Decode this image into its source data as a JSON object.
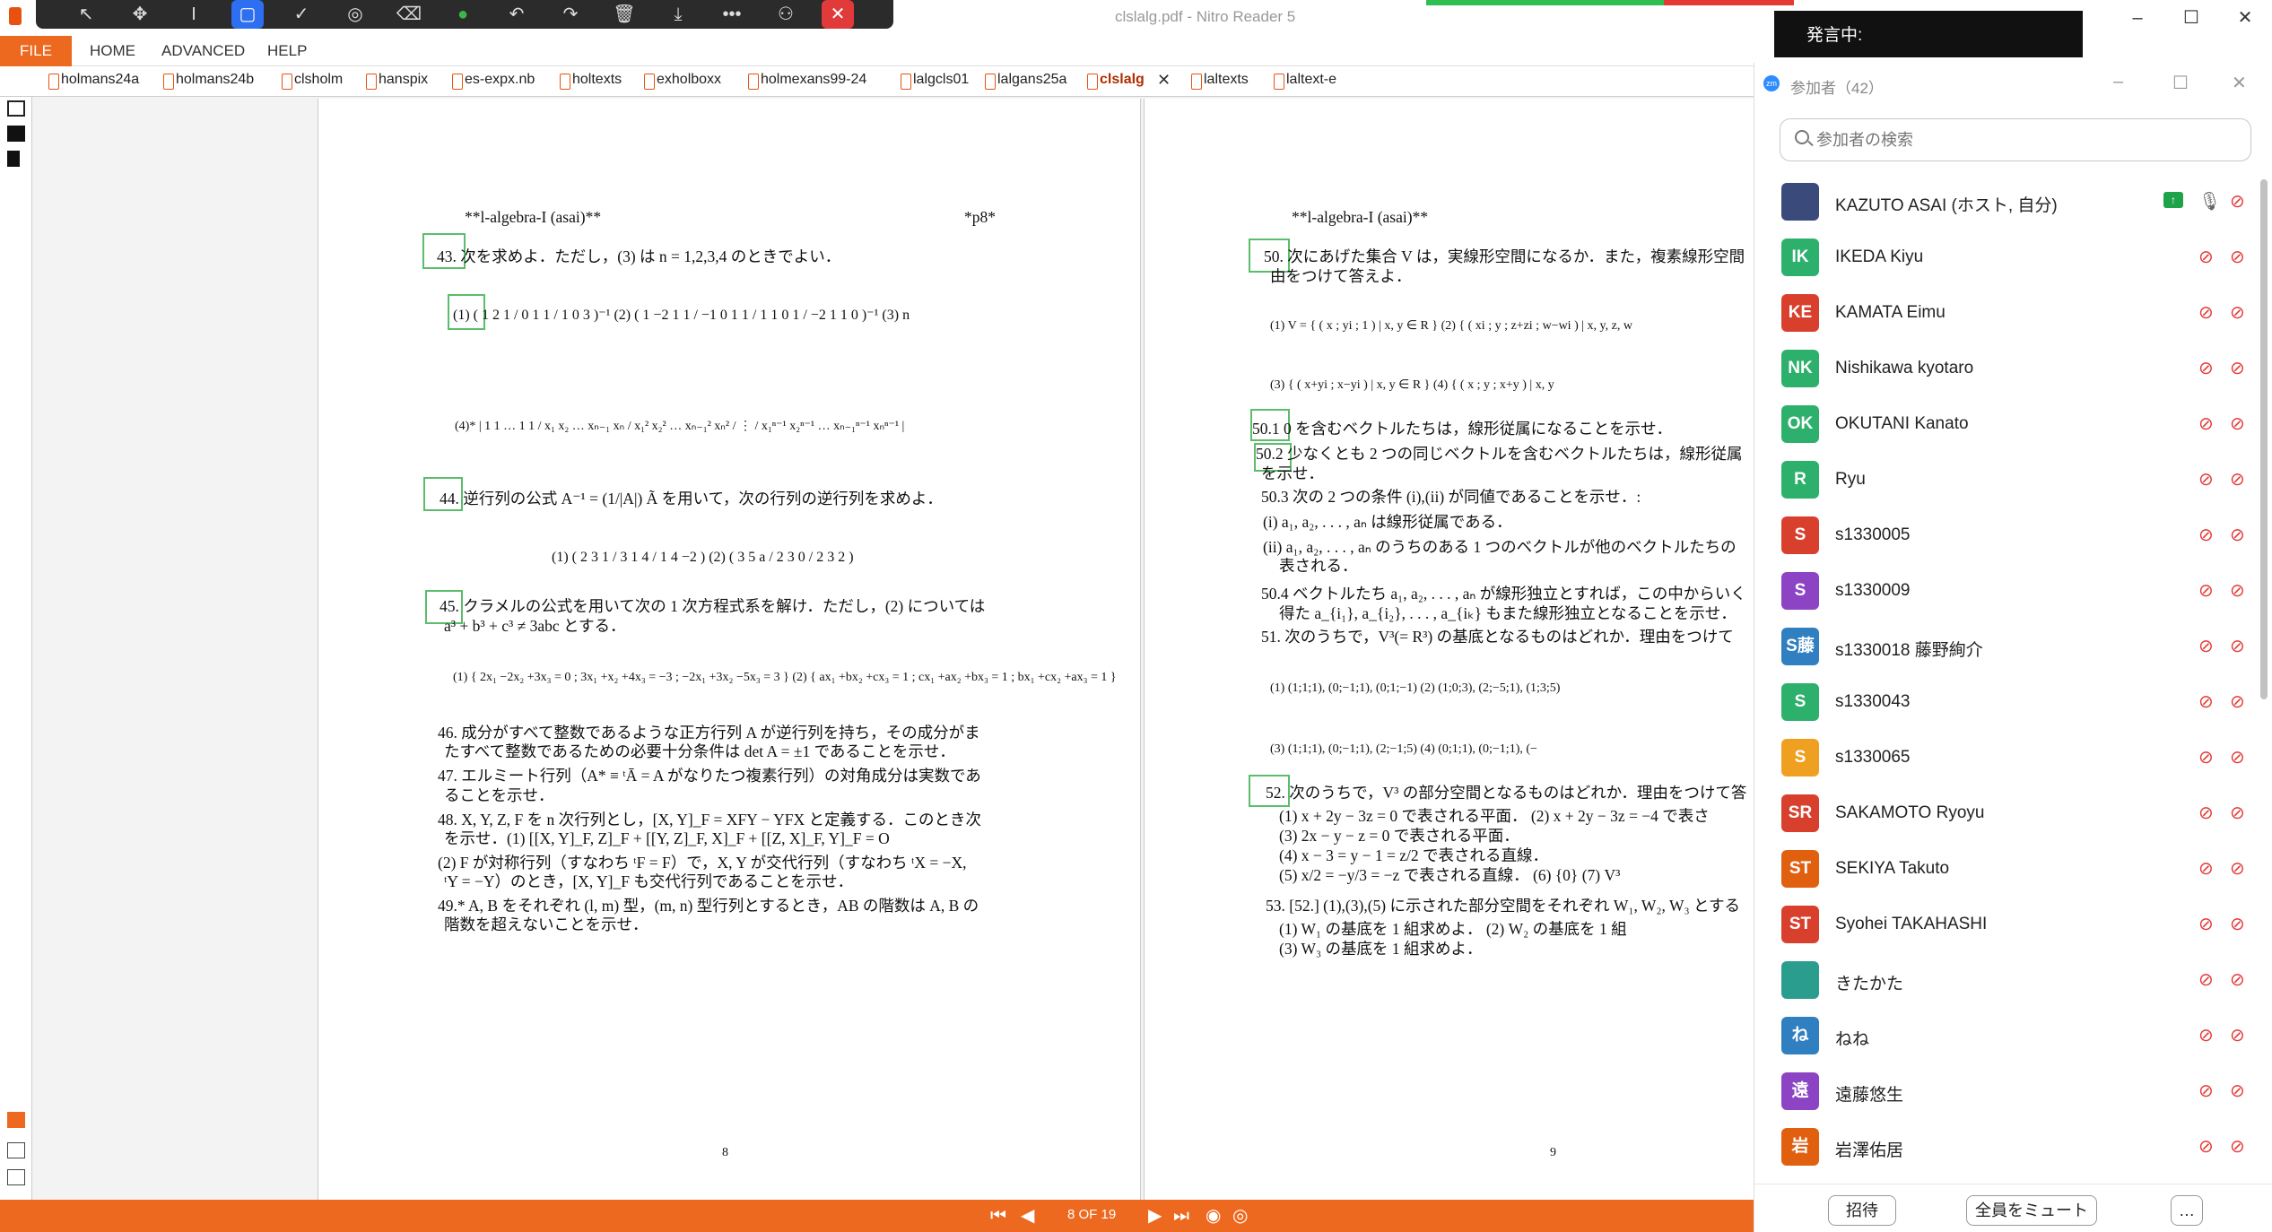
{
  "window": {
    "title": "clslalg.pdf - Nitro Reader 5",
    "controls": [
      "–",
      "☐",
      "✕"
    ]
  },
  "annotation_toolbar": {
    "icons": [
      "arrow-icon",
      "move-icon",
      "text-cursor-icon",
      "rectangle-icon",
      "check-icon",
      "stamp-icon",
      "eraser-icon",
      "green-dot-icon",
      "undo-icon",
      "redo-icon",
      "trash-icon",
      "download-icon",
      "more-icon",
      "people-icon",
      "close-icon"
    ]
  },
  "menu": {
    "file": "FILE",
    "home": "HOME",
    "advanced": "ADVANCED",
    "help": "HELP"
  },
  "tabs": [
    "holmans24a",
    "holmans24b",
    "clsholm",
    "hanspix",
    "es-expx.nb",
    "holtexts",
    "exholboxx",
    "holmexans99-24",
    "lalgcls01",
    "lalgans25a",
    "clslalg",
    "laltexts",
    "laltext-e"
  ],
  "active_tab": "clslalg",
  "page_left": {
    "header": "**l-algebra-I (asai)**",
    "header_right": "*p8*",
    "footer": "8",
    "lines": [
      "43. 次を求めよ．ただし，(3) は n = 1,2,3,4 のときでよい．",
      "(1) ( 1 2 1 / 0 1 1 / 1 0 3 )⁻¹     (2) ( 1 −2 1 1 / −1 0 1 1 / 1 1 0 1 / −2 1 1 0 )⁻¹     (3) n",
      "(4)*  | 1 1 … 1 1 / x₁ x₂ … xₙ₋₁ xₙ / x₁² x₂² … xₙ₋₁² xₙ² / ⋮ / x₁ⁿ⁻¹ x₂ⁿ⁻¹ … xₙ₋₁ⁿ⁻¹ xₙⁿ⁻¹ |",
      "44. 逆行列の公式 A⁻¹ = (1/|A|) Ã を用いて，次の行列の逆行列を求めよ．",
      "(1) ( 2 3 1 / 3 1 4 / 1 4 −2 )        (2) ( 3 5 a / 2 3 0 / 2 3 2 )",
      "45. クラメルの公式を用いて次の 1 次方程式系を解け．ただし，(2) については",
      "a³ + b³ + c³ ≠ 3abc とする．",
      "(1) { 2x₁ −2x₂ +3x₃ = 0 ; 3x₁ +x₂ +4x₃ = −3 ; −2x₁ +3x₂ −5x₃ = 3 }   (2) { ax₁ +bx₂ +cx₃ = 1 ; cx₁ +ax₂ +bx₃ = 1 ; bx₁ +cx₂ +ax₃ = 1 }",
      "46. 成分がすべて整数であるような正方行列 A が逆行列を持ち，その成分がま",
      "たすべて整数であるための必要十分条件は det A = ±1 であることを示せ．",
      "47. エルミート行列（A* ≡ ᵗĀ = A がなりたつ複素行列）の対角成分は実数であ",
      "ることを示せ．",
      "48. X, Y, Z, F を n 次行列とし，[X, Y]_F = XFY − YFX と定義する．このとき次",
      "を示せ．(1) [[X, Y]_F, Z]_F + [[Y, Z]_F, X]_F + [[Z, X]_F, Y]_F = O",
      "(2) F が対称行列（すなわち ᵗF = F）で，X, Y が交代行列（すなわち ᵗX = −X,",
      "ᵗY = −Y）のとき，[X, Y]_F も交代行列であることを示せ．",
      "49.* A, B をそれぞれ (l, m) 型，(m, n) 型行列とするとき，AB の階数は A, B の",
      "階数を超えないことを示せ．"
    ]
  },
  "page_right": {
    "header": "**l-algebra-I (asai)**",
    "footer": "9",
    "lines": [
      "50. 次にあげた集合 V は，実線形空間になるか．また，複素線形空間",
      "由をつけて答えよ．",
      "(1) V = { ( x ; yi ; 1 ) | x, y ∈ R }        (2) { ( xi ; y ; z+zi ; w−wi ) | x, y, z, w",
      "(3) { ( x+yi ; x−yi ) | x, y ∈ R }        (4) { ( x ; y ; x+y ) | x, y",
      "50.1 0 を含むベクトルたちは，線形従属になることを示せ．",
      "50.2 少なくとも 2 つの同じベクトルを含むベクトルたちは，線形従属",
      "を示せ．",
      "50.3 次の 2 つの条件 (i),(ii) が同値であることを示せ．:",
      "(i) a₁, a₂, . . . , aₙ は線形従属である．",
      "(ii) a₁, a₂, . . . , aₙ のうちのある 1 つのベクトルが他のベクトルたちの",
      "表される．",
      "50.4 ベクトルたち a₁, a₂, . . . , aₙ が線形独立とすれば，この中からいく",
      "得た a_{i₁}, a_{i₂}, . . . , a_{iₖ} もまた線形独立となることを示せ．",
      "51. 次のうちで，V³(= R³) の基底となるものはどれか．理由をつけて",
      "(1) (1;1;1), (0;−1;1), (0;1;−1)        (2) (1;0;3), (2;−5;1), (1;3;5)",
      "(3) (1;1;1), (0;−1;1), (2;−1;5)        (4) (0;1;1), (0;−1;1), (−",
      "52. 次のうちで，V³ の部分空間となるものはどれか．理由をつけて答",
      "(1) x + 2y − 3z = 0 で表される平面．  (2) x + 2y − 3z = −4 で表さ",
      "(3) 2x − y − z = 0 で表される平面．",
      "(4) x − 3 = y − 1 = z/2 で表される直線．",
      "(5) x/2 = −y/3 = −z で表される直線．     (6) {0}     (7) V³",
      "53. [52.] (1),(3),(5) に示された部分空間をそれぞれ W₁, W₂, W₃ とする",
      "(1) W₁ の基底を 1 組求めよ．                    (2) W₂ の基底を 1 組",
      "(3) W₃ の基底を 1 組求めよ．"
    ]
  },
  "navigation": {
    "page_indicator": "8 OF 19"
  },
  "zoom": {
    "speaking_label": "発言中:",
    "app_logo": "zm",
    "title": "参加者（42）",
    "search_placeholder": "参加者の検索",
    "participants": [
      {
        "initials": "",
        "name": "KAZUTO ASAI (ホスト, 自分)",
        "color": "#3a4a7a"
      },
      {
        "initials": "IK",
        "name": "IKEDA Kiyu",
        "color": "#2eb06d"
      },
      {
        "initials": "KE",
        "name": "KAMATA Eimu",
        "color": "#d8402d"
      },
      {
        "initials": "NK",
        "name": "Nishikawa kyotaro",
        "color": "#2eb06d"
      },
      {
        "initials": "OK",
        "name": "OKUTANI Kanato",
        "color": "#2eb06d"
      },
      {
        "initials": "R",
        "name": "Ryu",
        "color": "#2eb06d"
      },
      {
        "initials": "S",
        "name": "s1330005",
        "color": "#d8402d"
      },
      {
        "initials": "S",
        "name": "s1330009",
        "color": "#8c44c4"
      },
      {
        "initials": "S藤",
        "name": "s1330018 藤野絢介",
        "color": "#2f7fc1"
      },
      {
        "initials": "S",
        "name": "s1330043",
        "color": "#2eb06d"
      },
      {
        "initials": "S",
        "name": "s1330065",
        "color": "#f0a020"
      },
      {
        "initials": "SR",
        "name": "SAKAMOTO Ryoyu",
        "color": "#d8402d"
      },
      {
        "initials": "ST",
        "name": "SEKIYA Takuto",
        "color": "#e06010"
      },
      {
        "initials": "ST",
        "name": "Syohei TAKAHASHI",
        "color": "#d8402d"
      },
      {
        "initials": "",
        "name": "きたかた",
        "color": "#2a9d8f"
      },
      {
        "initials": "ね",
        "name": "ねね",
        "color": "#2f7fc1"
      },
      {
        "initials": "遠",
        "name": "遠藤悠生",
        "color": "#8c44c4"
      },
      {
        "initials": "岩",
        "name": "岩澤佑居",
        "color": "#e06010"
      }
    ],
    "invite_button": "招待",
    "mute_all_button": "全員をミュート",
    "more_button": "…"
  }
}
